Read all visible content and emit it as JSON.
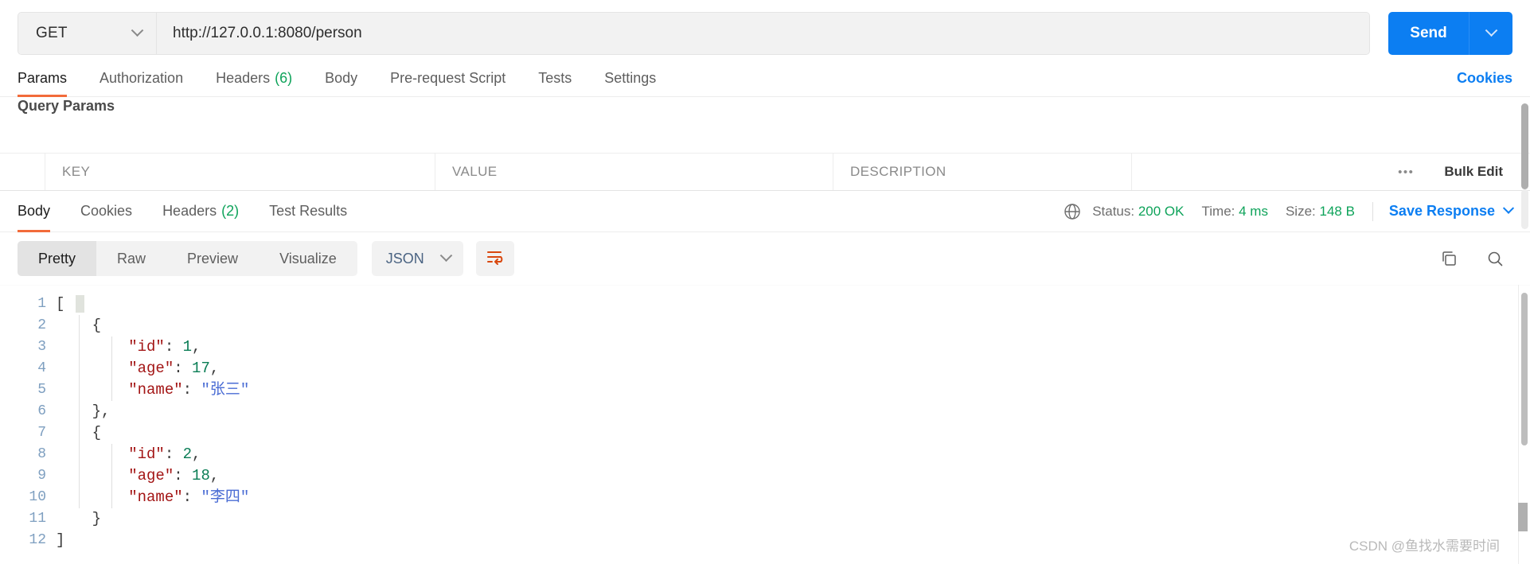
{
  "request": {
    "method": "GET",
    "url": "http://127.0.0.1:8080/person",
    "send_label": "Send",
    "tabs": [
      {
        "label": "Params",
        "count": "",
        "active": true
      },
      {
        "label": "Authorization",
        "count": "",
        "active": false
      },
      {
        "label": "Headers",
        "count": "(6)",
        "active": false
      },
      {
        "label": "Body",
        "count": "",
        "active": false
      },
      {
        "label": "Pre-request Script",
        "count": "",
        "active": false
      },
      {
        "label": "Tests",
        "count": "",
        "active": false
      },
      {
        "label": "Settings",
        "count": "",
        "active": false
      }
    ],
    "cookies_link": "Cookies"
  },
  "query_params": {
    "title": "Query Params",
    "columns": [
      "KEY",
      "VALUE",
      "DESCRIPTION"
    ],
    "more_icon": "•••",
    "bulk_edit_label": "Bulk Edit"
  },
  "response": {
    "tabs": [
      {
        "label": "Body",
        "count": "",
        "active": true
      },
      {
        "label": "Cookies",
        "count": "",
        "active": false
      },
      {
        "label": "Headers",
        "count": "(2)",
        "active": false
      },
      {
        "label": "Test Results",
        "count": "",
        "active": false
      }
    ],
    "status_label": "Status:",
    "status_value": "200 OK",
    "time_label": "Time:",
    "time_value": "4 ms",
    "size_label": "Size:",
    "size_value": "148 B",
    "save_response_label": "Save Response",
    "view_modes": [
      {
        "label": "Pretty",
        "active": true
      },
      {
        "label": "Raw",
        "active": false
      },
      {
        "label": "Preview",
        "active": false
      },
      {
        "label": "Visualize",
        "active": false
      }
    ],
    "format": "JSON",
    "body_lines": [
      {
        "no": "1",
        "indent": 0,
        "tokens": [
          {
            "t": "p",
            "v": "["
          }
        ]
      },
      {
        "no": "2",
        "indent": 1,
        "tokens": [
          {
            "t": "p",
            "v": "{"
          }
        ]
      },
      {
        "no": "3",
        "indent": 2,
        "tokens": [
          {
            "t": "k",
            "v": "\"id\""
          },
          {
            "t": "p",
            "v": ": "
          },
          {
            "t": "n",
            "v": "1"
          },
          {
            "t": "p",
            "v": ","
          }
        ]
      },
      {
        "no": "4",
        "indent": 2,
        "tokens": [
          {
            "t": "k",
            "v": "\"age\""
          },
          {
            "t": "p",
            "v": ": "
          },
          {
            "t": "n",
            "v": "17"
          },
          {
            "t": "p",
            "v": ","
          }
        ]
      },
      {
        "no": "5",
        "indent": 2,
        "tokens": [
          {
            "t": "k",
            "v": "\"name\""
          },
          {
            "t": "p",
            "v": ": "
          },
          {
            "t": "s",
            "v": "\"张三\""
          }
        ]
      },
      {
        "no": "6",
        "indent": 1,
        "tokens": [
          {
            "t": "p",
            "v": "},"
          }
        ]
      },
      {
        "no": "7",
        "indent": 1,
        "tokens": [
          {
            "t": "p",
            "v": "{"
          }
        ]
      },
      {
        "no": "8",
        "indent": 2,
        "tokens": [
          {
            "t": "k",
            "v": "\"id\""
          },
          {
            "t": "p",
            "v": ": "
          },
          {
            "t": "n",
            "v": "2"
          },
          {
            "t": "p",
            "v": ","
          }
        ]
      },
      {
        "no": "9",
        "indent": 2,
        "tokens": [
          {
            "t": "k",
            "v": "\"age\""
          },
          {
            "t": "p",
            "v": ": "
          },
          {
            "t": "n",
            "v": "18"
          },
          {
            "t": "p",
            "v": ","
          }
        ]
      },
      {
        "no": "10",
        "indent": 2,
        "tokens": [
          {
            "t": "k",
            "v": "\"name\""
          },
          {
            "t": "p",
            "v": ": "
          },
          {
            "t": "s",
            "v": "\"李四\""
          }
        ]
      },
      {
        "no": "11",
        "indent": 1,
        "tokens": [
          {
            "t": "p",
            "v": "}"
          }
        ]
      },
      {
        "no": "12",
        "indent": 0,
        "tokens": [
          {
            "t": "p",
            "v": "]"
          }
        ]
      }
    ]
  },
  "watermark": "CSDN @鱼找水需要时间",
  "colors": {
    "accent_blue": "#0c7ef2",
    "tab_underline": "#f26b3a",
    "success_green": "#0ea35a",
    "json_key": "#a31515",
    "json_number": "#0a7d55",
    "json_string": "#4a6cd4",
    "wrap_icon": "#d9480f"
  }
}
